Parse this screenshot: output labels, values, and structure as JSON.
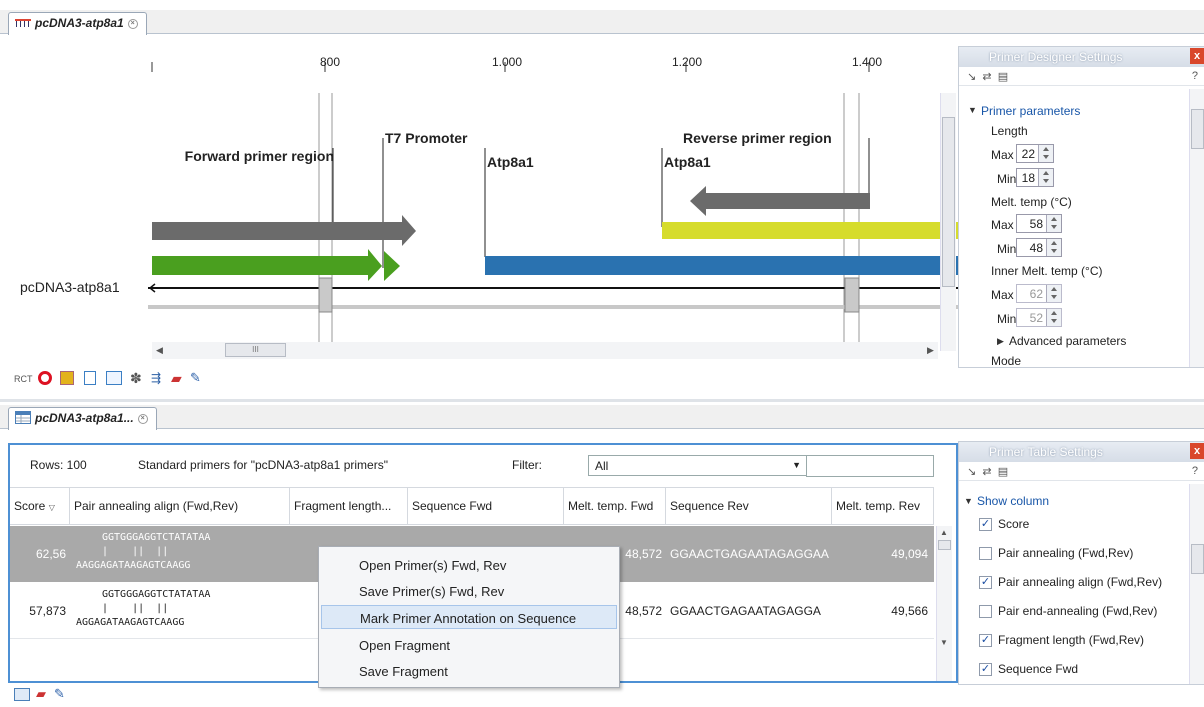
{
  "top_tab": {
    "title": "pcDNA3-atp8a1"
  },
  "sequence_view": {
    "ruler": [
      "800",
      "1.000",
      "1.200",
      "1.400"
    ],
    "annotations": {
      "forward_region": "Forward primer region",
      "t7": "T7 Promoter",
      "atp_left": "Atp8a1",
      "atp_right": "Atp8a1",
      "reverse_region": "Reverse primer region"
    },
    "sequence_name": "pcDNA3-atp8a1",
    "hscroll_grip": "III"
  },
  "designer": {
    "title": "Primer Designer Settings",
    "close": "x",
    "help": "?",
    "section": "Primer parameters",
    "length_label": "Length",
    "max_label": "Max",
    "min_label": "Min",
    "length_max": "22",
    "length_min": "18",
    "melt_label": "Melt. temp (°C)",
    "melt_max": "58",
    "melt_min": "48",
    "inner_melt_label": "Inner Melt. temp (°C)",
    "inner_max": "62",
    "inner_min": "52",
    "advanced": "Advanced parameters",
    "mode": "Mode"
  },
  "bottom_tab": {
    "title": "pcDNA3-atp8a1..."
  },
  "table": {
    "rows_label": "Rows: 100",
    "description": "Standard primers for \"pcDNA3-atp8a1 primers\"",
    "filter_label": "Filter:",
    "filter_value": "All",
    "filter_text": "",
    "columns": [
      "Score",
      "Pair annealing align (Fwd,Rev)",
      "Fragment length...",
      "Sequence Fwd",
      "Melt. temp. Fwd",
      "Sequence Rev",
      "Melt. temp. Rev"
    ],
    "rows": [
      {
        "score": "62,56",
        "align_top": "GGTGGGAGGTCTATATAA",
        "align_mid": "|    ||  ||",
        "align_bot": "AAGGAGATAAGAGTCAAGG",
        "melt_fwd": "48,572",
        "seq_rev": "GGAACTGAGAATAGAGGAA",
        "melt_rev": "49,094"
      },
      {
        "score": "57,873",
        "align_top": "GGTGGGAGGTCTATATAA",
        "align_mid": "|    ||  ||",
        "align_bot": "AGGAGATAAGAGTCAAGG",
        "melt_fwd": "48,572",
        "seq_rev": "GGAACTGAGAATAGAGGA",
        "melt_rev": "49,566"
      }
    ]
  },
  "context_menu": {
    "items": [
      "Open Primer(s)  Fwd, Rev",
      "Save Primer(s)  Fwd, Rev",
      "Mark Primer Annotation on Sequence",
      "Open Fragment",
      "Save Fragment"
    ]
  },
  "table_settings": {
    "title": "Primer Table Settings",
    "close": "x",
    "help": "?",
    "section": "Show column",
    "options": [
      {
        "label": "Score",
        "checked": true
      },
      {
        "label": "Pair annealing (Fwd,Rev)",
        "checked": false
      },
      {
        "label": "Pair annealing align (Fwd,Rev)",
        "checked": true
      },
      {
        "label": "Pair end-annealing (Fwd,Rev)",
        "checked": false
      },
      {
        "label": "Fragment length (Fwd,Rev)",
        "checked": true
      },
      {
        "label": "Sequence Fwd",
        "checked": true
      }
    ]
  },
  "colors": {
    "grey_arrow": "#6b6b6b",
    "green": "#4a9f1f",
    "blue": "#2a72b0",
    "yellow": "#d6dc2c",
    "row_selected": "#a9a9a9",
    "focus": "#4d90d4"
  }
}
